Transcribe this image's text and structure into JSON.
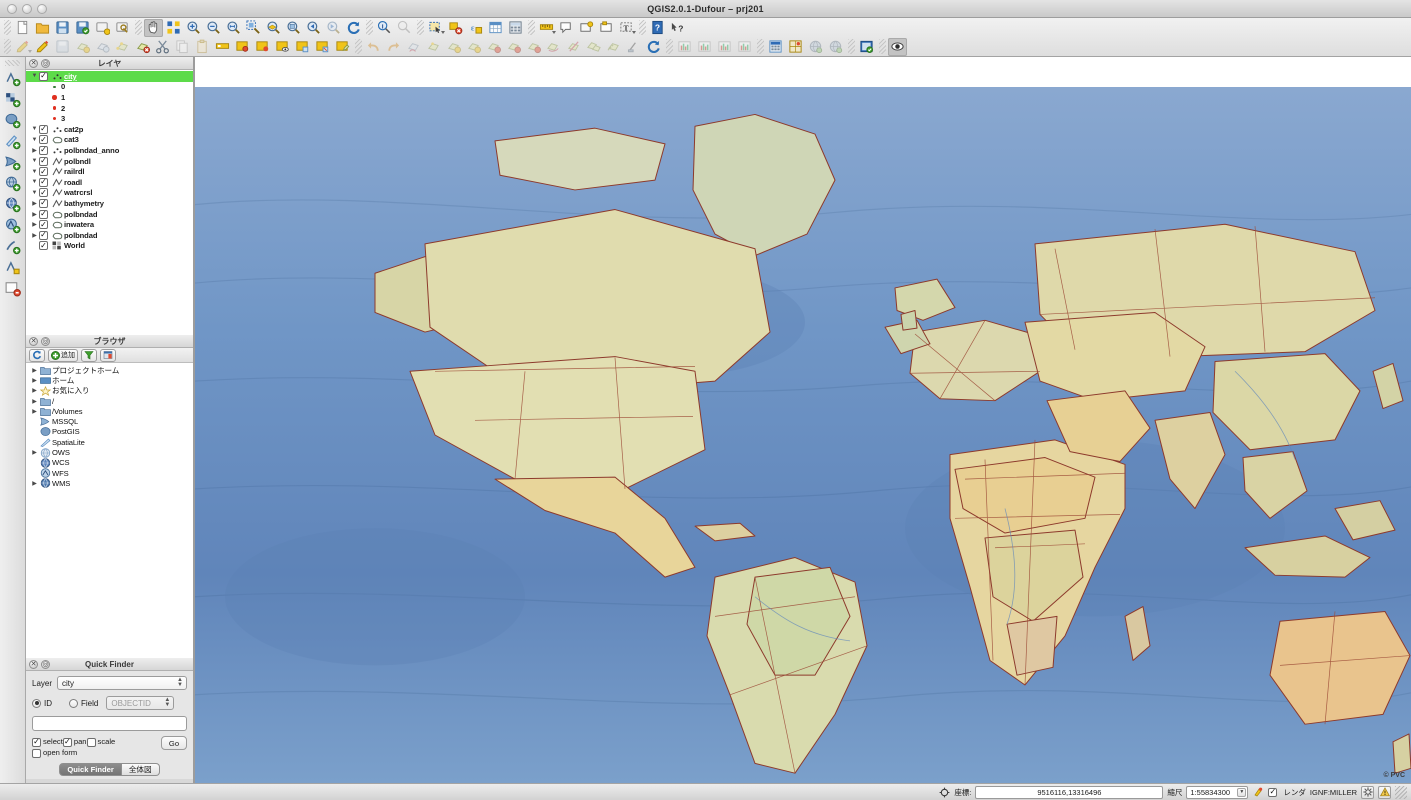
{
  "window": {
    "title": "QGIS2.0.1-Dufour – prj201",
    "traffic_lights": [
      "close",
      "minimize",
      "zoom"
    ]
  },
  "toolbars": {
    "row1": [
      {
        "name": "new-project-icon",
        "label": "New Project",
        "enabled": true
      },
      {
        "name": "open-project-icon",
        "label": "Open Project",
        "enabled": true
      },
      {
        "name": "save-project-icon",
        "label": "Save Project",
        "enabled": true
      },
      {
        "name": "save-project-as-icon",
        "label": "Save Project As",
        "enabled": true
      },
      {
        "name": "new-print-composer-icon",
        "label": "New Print Composer",
        "enabled": true
      },
      {
        "name": "composer-manager-icon",
        "label": "Composer Manager",
        "enabled": true
      },
      {
        "name": "pan-map-icon",
        "label": "Pan Map",
        "enabled": true,
        "active": true
      },
      {
        "name": "pan-to-selection-icon",
        "label": "Pan Map to Selection",
        "enabled": true
      },
      {
        "name": "zoom-in-icon",
        "label": "Zoom In",
        "enabled": true
      },
      {
        "name": "zoom-out-icon",
        "label": "Zoom Out",
        "enabled": true
      },
      {
        "name": "zoom-full-icon",
        "label": "Zoom Full",
        "enabled": true
      },
      {
        "name": "zoom-to-selection-icon",
        "label": "Zoom To Selection",
        "enabled": true
      },
      {
        "name": "zoom-to-layer-icon",
        "label": "Zoom To Layer",
        "enabled": true
      },
      {
        "name": "zoom-native-icon",
        "label": "Zoom To Native Resolution",
        "enabled": true
      },
      {
        "name": "zoom-last-icon",
        "label": "Zoom Last",
        "enabled": true
      },
      {
        "name": "zoom-next-icon",
        "label": "Zoom Next",
        "enabled": false
      },
      {
        "name": "refresh-icon",
        "label": "Refresh",
        "enabled": true
      },
      {
        "name": "identify-features-icon",
        "label": "Identify Features",
        "enabled": true
      },
      {
        "name": "map-tips-icon",
        "label": "Show Map Tips",
        "enabled": false
      },
      {
        "name": "select-features-icon",
        "label": "Select Features",
        "enabled": true,
        "caret": true
      },
      {
        "name": "deselect-icon",
        "label": "Deselect Features",
        "enabled": true
      },
      {
        "name": "select-expression-icon",
        "label": "Select By Expression",
        "enabled": true
      },
      {
        "name": "open-attribute-table-icon",
        "label": "Open Attribute Table",
        "enabled": true
      },
      {
        "name": "field-calculator-icon",
        "label": "Field Calculator",
        "enabled": true
      },
      {
        "name": "measure-line-icon",
        "label": "Measure Line",
        "enabled": true,
        "caret": true
      },
      {
        "name": "text-annotation-icon",
        "label": "Text Annotation",
        "enabled": true
      },
      {
        "name": "form-annotation-icon",
        "label": "Form Annotation",
        "enabled": true
      },
      {
        "name": "move-annotation-icon",
        "label": "Move Annotation",
        "enabled": true
      },
      {
        "name": "label-tool-icon",
        "label": "Label Tool",
        "enabled": true,
        "caret": true
      },
      {
        "name": "help-contents-icon",
        "label": "Help Contents",
        "enabled": true
      },
      {
        "name": "whats-this-icon",
        "label": "What's This",
        "enabled": true
      }
    ],
    "row2": [
      {
        "name": "current-edits-icon",
        "label": "Current Edits",
        "enabled": false,
        "caret": true
      },
      {
        "name": "toggle-editing-icon",
        "label": "Toggle Editing",
        "enabled": true
      },
      {
        "name": "save-layer-edits-icon",
        "label": "Save Layer Edits",
        "enabled": false
      },
      {
        "name": "add-feature-icon",
        "label": "Add Feature",
        "enabled": false
      },
      {
        "name": "move-feature-icon",
        "label": "Move Feature",
        "enabled": false
      },
      {
        "name": "node-tool-icon",
        "label": "Node Tool",
        "enabled": false
      },
      {
        "name": "delete-selected-icon",
        "label": "Delete Selected",
        "enabled": true
      },
      {
        "name": "cut-features-icon",
        "label": "Cut Features",
        "enabled": true
      },
      {
        "name": "copy-features-icon",
        "label": "Copy Features",
        "enabled": false
      },
      {
        "name": "paste-features-icon",
        "label": "Paste Features",
        "enabled": false
      },
      {
        "name": "measure-area-icon",
        "label": "Measure Area",
        "enabled": true
      },
      {
        "name": "new-bookmark-icon",
        "label": "New Bookmark",
        "enabled": true
      },
      {
        "name": "show-bookmarks-icon",
        "label": "Show Bookmarks",
        "enabled": true
      },
      {
        "name": "hide-deselected-icon",
        "label": "Hide Deselected",
        "enabled": true
      },
      {
        "name": "show-all-layers-icon",
        "label": "Show All Layers",
        "enabled": true
      },
      {
        "name": "hide-all-layers-icon",
        "label": "Hide All Layers",
        "enabled": true
      },
      {
        "name": "edit-layer-icon",
        "label": "Edit Layer",
        "enabled": true
      },
      {
        "name": "undo-icon",
        "label": "Undo",
        "enabled": false
      },
      {
        "name": "redo-icon",
        "label": "Redo",
        "enabled": false
      },
      {
        "name": "rotate-point-icon",
        "label": "Rotate Point Symbols",
        "enabled": false
      },
      {
        "name": "simplify-feature-icon",
        "label": "Simplify Feature",
        "enabled": false
      },
      {
        "name": "add-ring-icon",
        "label": "Add Ring",
        "enabled": false
      },
      {
        "name": "add-part-icon",
        "label": "Add Part",
        "enabled": false
      },
      {
        "name": "fill-ring-icon",
        "label": "Fill Ring",
        "enabled": false
      },
      {
        "name": "delete-ring-icon",
        "label": "Delete Ring",
        "enabled": false
      },
      {
        "name": "delete-part-icon",
        "label": "Delete Part",
        "enabled": false
      },
      {
        "name": "reshape-features-icon",
        "label": "Reshape Features",
        "enabled": false
      },
      {
        "name": "split-features-icon",
        "label": "Split Features",
        "enabled": false
      },
      {
        "name": "merge-features-icon",
        "label": "Merge Features",
        "enabled": false
      },
      {
        "name": "offset-curve-icon",
        "label": "Offset Curve",
        "enabled": false
      },
      {
        "name": "rotate-label-icon",
        "label": "Rotate Label",
        "enabled": false
      },
      {
        "name": "refresh-plugin-icon",
        "label": "Refresh",
        "enabled": true
      },
      {
        "name": "histogram-icon",
        "label": "Histogram",
        "enabled": false
      },
      {
        "name": "statistics-icon",
        "label": "Statistics",
        "enabled": false
      },
      {
        "name": "graph-icon",
        "label": "Graph",
        "enabled": false
      },
      {
        "name": "analysis-icon",
        "label": "Analysis",
        "enabled": false
      },
      {
        "name": "raster-calc-icon",
        "label": "Raster Calculator",
        "enabled": true
      },
      {
        "name": "georeferencer-icon",
        "label": "Georeferencer",
        "enabled": true
      },
      {
        "name": "globe-plugin-icon",
        "label": "Globe Plugin",
        "enabled": false
      },
      {
        "name": "globe-settings-icon",
        "label": "Globe Settings",
        "enabled": false
      },
      {
        "name": "quick-finder-plugin-icon",
        "label": "Quick Finder Plugin",
        "enabled": true
      },
      {
        "name": "preview-mode-icon",
        "label": "Preview Mode",
        "enabled": true,
        "active": true
      }
    ],
    "vertical": [
      {
        "name": "add-vector-layer-icon",
        "label": "Add Vector Layer"
      },
      {
        "name": "add-raster-layer-icon",
        "label": "Add Raster Layer"
      },
      {
        "name": "add-postgis-layer-icon",
        "label": "Add PostGIS Layer"
      },
      {
        "name": "add-spatialite-layer-icon",
        "label": "Add SpatiaLite Layer"
      },
      {
        "name": "add-mssql-layer-icon",
        "label": "Add MSSQL Spatial Layer"
      },
      {
        "name": "add-wms-layer-icon",
        "label": "Add WMS/WMTS Layer"
      },
      {
        "name": "add-wcs-layer-icon",
        "label": "Add WCS Layer"
      },
      {
        "name": "add-wfs-layer-icon",
        "label": "Add WFS Layer"
      },
      {
        "name": "add-delimited-text-icon",
        "label": "Add Delimited Text Layer"
      },
      {
        "name": "new-shapefile-layer-icon",
        "label": "New Shapefile Layer"
      },
      {
        "name": "remove-layer-icon",
        "label": "Remove Layer"
      }
    ]
  },
  "layers_panel": {
    "title": "レイヤ",
    "items": [
      {
        "name": "city",
        "checked": true,
        "expanded": true,
        "selected": true,
        "symbol": "point",
        "indent": 0
      },
      {
        "name": "0",
        "checked": null,
        "symbol": "dot-tiny",
        "indent": 1
      },
      {
        "name": "1",
        "checked": null,
        "symbol": "dot-large",
        "indent": 1
      },
      {
        "name": "2",
        "checked": null,
        "symbol": "dot-med",
        "indent": 1
      },
      {
        "name": "3",
        "checked": null,
        "symbol": "dot-small",
        "indent": 1
      },
      {
        "name": "cat2p",
        "checked": true,
        "expanded": true,
        "symbol": "point",
        "indent": 0
      },
      {
        "name": "cat3",
        "checked": true,
        "expanded": true,
        "symbol": "polygon",
        "indent": 0
      },
      {
        "name": "polbndad_anno",
        "checked": true,
        "expanded": false,
        "symbol": "point",
        "indent": 0
      },
      {
        "name": "polbndl",
        "checked": true,
        "expanded": true,
        "symbol": "line",
        "indent": 0
      },
      {
        "name": "railrdl",
        "checked": true,
        "expanded": true,
        "symbol": "line",
        "indent": 0
      },
      {
        "name": "roadl",
        "checked": true,
        "expanded": true,
        "symbol": "line",
        "indent": 0
      },
      {
        "name": "watrcrsl",
        "checked": true,
        "expanded": true,
        "symbol": "line",
        "indent": 0
      },
      {
        "name": "bathymetry",
        "checked": true,
        "expanded": false,
        "symbol": "line",
        "indent": 0
      },
      {
        "name": "polbndad",
        "checked": true,
        "expanded": false,
        "symbol": "polygon",
        "indent": 0
      },
      {
        "name": "inwatera",
        "checked": true,
        "expanded": false,
        "symbol": "polygon",
        "indent": 0
      },
      {
        "name": "polbndad",
        "checked": true,
        "expanded": false,
        "symbol": "polygon",
        "indent": 0
      },
      {
        "name": "World",
        "checked": true,
        "expanded": null,
        "symbol": "raster",
        "indent": 0
      }
    ]
  },
  "browser_panel": {
    "title": "ブラウザ",
    "toolbar": {
      "refresh_label": "",
      "add_label": "追加",
      "filter_label": "",
      "collapse_label": ""
    },
    "items": [
      {
        "label": "プロジェクトホーム",
        "icon": "folder-icon",
        "expandable": true
      },
      {
        "label": "ホーム",
        "icon": "home-folder-icon",
        "expandable": true
      },
      {
        "label": "お気に入り",
        "icon": "star-icon",
        "expandable": true
      },
      {
        "label": "/",
        "icon": "folder-icon",
        "expandable": true
      },
      {
        "label": "/Volumes",
        "icon": "folder-icon",
        "expandable": true
      },
      {
        "label": "MSSQL",
        "icon": "mssql-icon",
        "expandable": false
      },
      {
        "label": "PostGIS",
        "icon": "postgis-icon",
        "expandable": false
      },
      {
        "label": "SpatiaLite",
        "icon": "spatialite-icon",
        "expandable": false
      },
      {
        "label": "OWS",
        "icon": "ows-icon",
        "expandable": true
      },
      {
        "label": "WCS",
        "icon": "wcs-icon",
        "expandable": false
      },
      {
        "label": "WFS",
        "icon": "wfs-icon",
        "expandable": false
      },
      {
        "label": "WMS",
        "icon": "wms-icon",
        "expandable": true
      }
    ]
  },
  "quick_finder": {
    "title": "Quick Finder",
    "layer_label": "Layer",
    "layer_value": "city",
    "id_label": "ID",
    "id_selected": true,
    "field_label": "Field",
    "field_selected": false,
    "field_value": "OBJECTID",
    "search_value": "",
    "checkboxes": [
      {
        "label": "select",
        "checked": true
      },
      {
        "label": "pan",
        "checked": true
      },
      {
        "label": "scale",
        "checked": false
      },
      {
        "label": "open form",
        "checked": false
      }
    ],
    "go_label": "Go",
    "tabs": [
      {
        "label": "Quick Finder",
        "active": true
      },
      {
        "label": "全体図",
        "active": false
      }
    ]
  },
  "map": {
    "credit": "© PVC",
    "ocean_color": "#6e92c2",
    "land_colors": [
      "#e3dfa8",
      "#d8cf9c",
      "#cbbf92",
      "#e9c98f",
      "#dcae9b",
      "#c9d3a2",
      "#e6d8a6",
      "#d3b9a3"
    ],
    "border_color": "#8d3a2c"
  },
  "statusbar": {
    "locate_icon": "crosshair-icon",
    "coord_label": "座標:",
    "coord_value": "9516116,13316496",
    "scale_label": "縮尺",
    "scale_value": "1:55834300",
    "lock_icon": "scale-lock-icon",
    "render_label": "レンダ",
    "render_checked": true,
    "crs_value": "IGNF:MILLER",
    "crs_icon": "projection-icon",
    "messages_icon": "warning-icon"
  }
}
